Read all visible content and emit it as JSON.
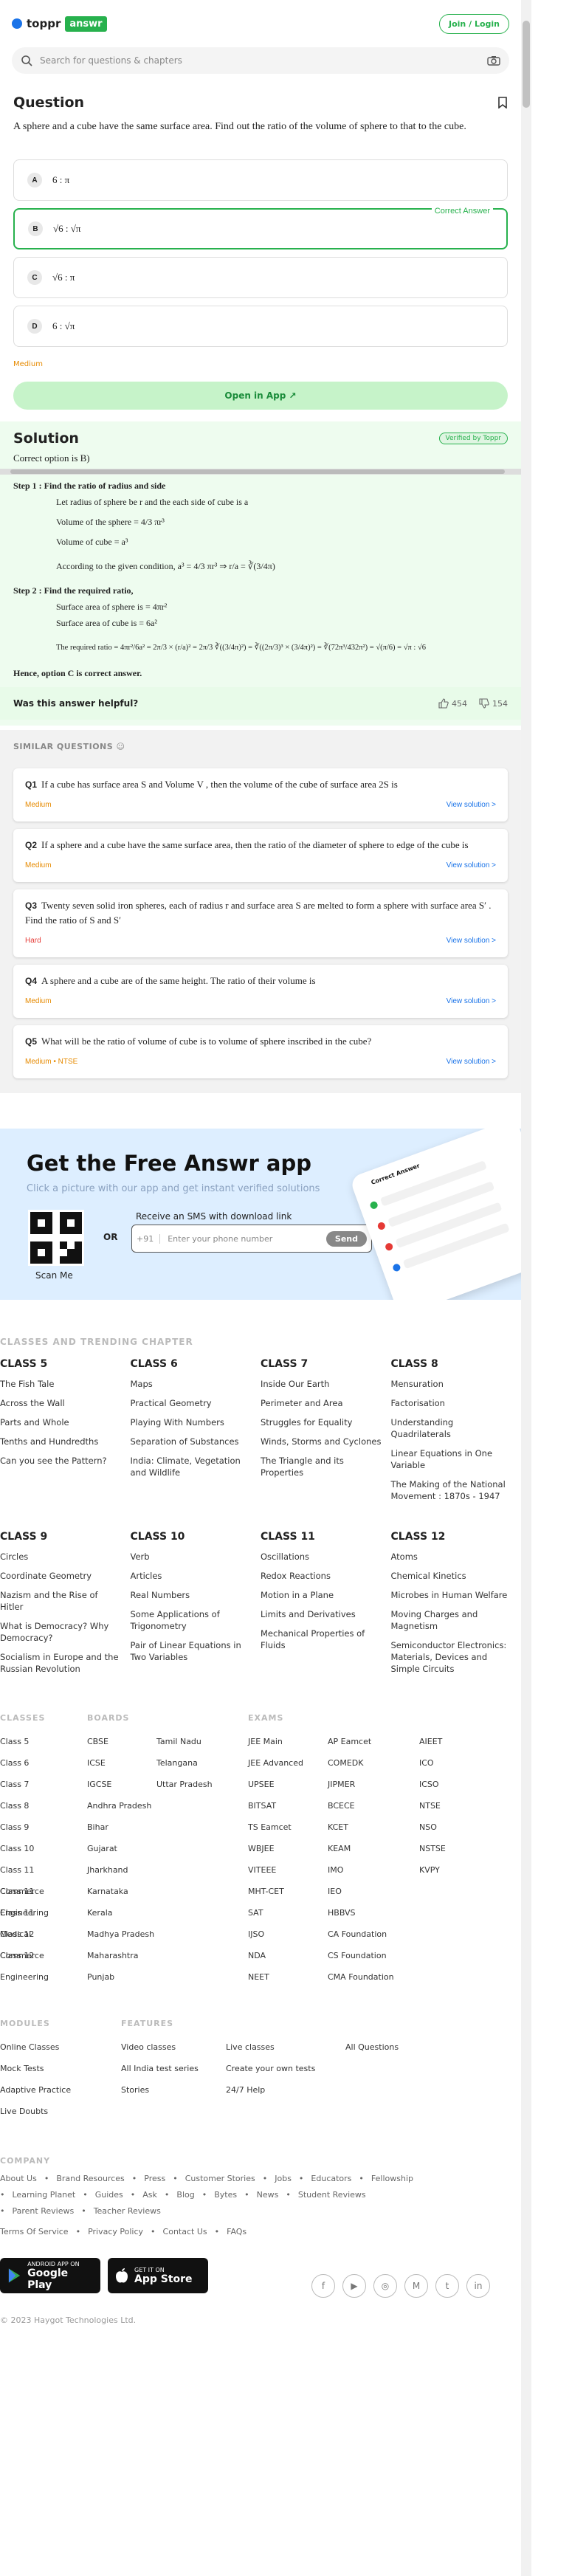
{
  "header": {
    "brand_left": "toppr",
    "brand_right": "answr",
    "login": "Join / Login"
  },
  "search": {
    "placeholder": "Search for questions & chapters"
  },
  "question": {
    "heading": "Question",
    "text": "A sphere and a cube have the same surface area. Find out the ratio of the volume of sphere to that to the cube.",
    "options": [
      {
        "letter": "A",
        "text": "6 : π"
      },
      {
        "letter": "B",
        "text": "√6 : √π",
        "correct": true
      },
      {
        "letter": "C",
        "text": "√6 : π"
      },
      {
        "letter": "D",
        "text": "6 : √π"
      }
    ],
    "correct_label": "Correct Answer",
    "difficulty": "Medium",
    "open_app": "Open in App ↗"
  },
  "solution": {
    "heading": "Solution",
    "verified": "Verified by Toppr",
    "correct_option": "Correct option is B)",
    "step1": "Step 1 : Find the ratio of radius and side",
    "step1_lines": [
      "Let radius of sphere be r and the each side of cube is a",
      "Volume of the sphere = 4/3 πr³",
      "Volume of cube = a³",
      "According to the given condition, a³ = 4/3 πr³ ⇒ r/a = ∛(3/4π)"
    ],
    "step2": "Step 2 : Find the required ratio,",
    "step2_lines": [
      "Surface area of sphere is = 4πr²",
      "Surface area of cube is = 6a²",
      "The required ratio = 4πr²/6a² = 2π/3 × (r/a)² = 2π/3 ∛((3/4π)²) = ∛((2π/3)³ × (3/4π)²) = ∛(72π³/432π²) = √(π/6) = √π : √6"
    ],
    "hence": "Hence, option C is correct answer.",
    "helpful": "Was this answer helpful?",
    "likes": "454",
    "dislikes": "154"
  },
  "similar": {
    "title": "SIMILAR QUESTIONS",
    "items": [
      {
        "n": "Q1",
        "text": "If a cube has surface area S and Volume V , then the volume of the cube of surface area 2S is",
        "difficulty": "Medium",
        "cta": "View solution >"
      },
      {
        "n": "Q2",
        "text": "If a sphere and a cube have the same surface area, then the ratio of the diameter of sphere to edge of the cube is",
        "difficulty": "Medium",
        "cta": "View solution >"
      },
      {
        "n": "Q3",
        "text": "Twenty seven solid iron spheres, each of radius r and surface area S are melted to form a sphere with surface area S′ . Find the ratio of S and S′",
        "difficulty": "Hard",
        "cta": "View solution >"
      },
      {
        "n": "Q4",
        "text": "A sphere and a cube are of the same height. The ratio of their volume is",
        "difficulty": "Medium",
        "cta": "View solution >"
      },
      {
        "n": "Q5",
        "text": "What will be the ratio of volume of cube is to volume of sphere inscribed in the cube?",
        "difficulty": "Medium • NTSE",
        "cta": "View solution >"
      }
    ]
  },
  "app": {
    "title": "Get the Free Answr app",
    "subtitle": "Click a picture with our app and get instant verified solutions",
    "scan": "Scan Me",
    "or": "OR",
    "sms": "Receive an SMS with download link",
    "cc": "+91",
    "phone_placeholder": "Enter your phone number",
    "send": "Send",
    "mock_title": "Correct Answer"
  },
  "classes": {
    "heading": "CLASSES AND TRENDING CHAPTER",
    "groups": [
      {
        "title": "CLASS 5",
        "items": [
          "The Fish Tale",
          "Across the Wall",
          "Parts and Whole",
          "Tenths and Hundredths",
          "Can you see the Pattern?"
        ]
      },
      {
        "title": "CLASS 6",
        "items": [
          "Maps",
          "Practical Geometry",
          "Playing With Numbers",
          "Separation of Substances",
          "India: Climate, Vegetation and Wildlife"
        ]
      },
      {
        "title": "CLASS 7",
        "items": [
          "Inside Our Earth",
          "Perimeter and Area",
          "Struggles for Equality",
          "Winds, Storms and Cyclones",
          "The Triangle and its Properties"
        ]
      },
      {
        "title": "CLASS 8",
        "items": [
          "Mensuration",
          "Factorisation",
          "Understanding Quadrilaterals",
          "Linear Equations in One Variable",
          "The Making of the National Movement : 1870s - 1947"
        ]
      },
      {
        "title": "CLASS 9",
        "items": [
          "Circles",
          "Coordinate Geometry",
          "Nazism and the Rise of Hitler",
          "What is Democracy? Why Democracy?",
          "Socialism in Europe and the Russian Revolution"
        ]
      },
      {
        "title": "CLASS 10",
        "items": [
          "Verb",
          "Articles",
          "Real Numbers",
          "Some Applications of Trigonometry",
          "Pair of Linear Equations in Two Variables"
        ]
      },
      {
        "title": "CLASS 11",
        "items": [
          "Oscillations",
          "Redox Reactions",
          "Motion in a Plane",
          "Limits and Derivatives",
          "Mechanical Properties of Fluids"
        ]
      },
      {
        "title": "CLASS 12",
        "items": [
          "Atoms",
          "Chemical Kinetics",
          "Microbes in Human Welfare",
          "Moving Charges and Magnetism",
          "Semiconductor Electronics: Materials, Devices and Simple Circuits"
        ]
      }
    ]
  },
  "directory": {
    "classes_h": "CLASSES",
    "classes": [
      "Class 5",
      "Class 6",
      "Class 7",
      "Class 8",
      "Class 9",
      "Class 10",
      "Class 11 Commerce",
      "Class 11 Engineering",
      "Class 11 Medical",
      "Class 12 Commerce",
      "Class 12 Engineering"
    ],
    "boards_h": "BOARDS",
    "boards1": [
      "CBSE",
      "ICSE",
      "IGCSE",
      "Andhra Pradesh",
      "Bihar",
      "Gujarat",
      "Jharkhand",
      "Karnataka",
      "Kerala",
      "Madhya Pradesh",
      "Maharashtra",
      "Punjab"
    ],
    "boards2": [
      "Tamil Nadu",
      "Telangana",
      "Uttar Pradesh"
    ],
    "exams_h": "EXAMS",
    "exams1": [
      "JEE Main",
      "JEE Advanced",
      "UPSEE",
      "BITSAT",
      "TS Eamcet",
      "WBJEE",
      "VITEEE",
      "MHT-CET",
      "SAT",
      "IJSO",
      "NDA",
      "NEET"
    ],
    "exams2": [
      "AP Eamcet",
      "COMEDK",
      "JIPMER",
      "BCECE",
      "KCET",
      "KEAM",
      "IMO",
      "IEO",
      "HBBVS",
      "CA Foundation",
      "CS Foundation",
      "CMA Foundation"
    ],
    "exams3": [
      "AIEET",
      "ICO",
      "ICSO",
      "NTSE",
      "NSO",
      "NSTSE",
      "KVPY"
    ]
  },
  "modules": {
    "h": "MODULES",
    "col1": [
      "Online Classes",
      "Mock Tests",
      "Adaptive Practice",
      "Live Doubts"
    ],
    "features_h": "FEATURES",
    "col2": [
      "Video classes",
      "All India test series",
      "Stories"
    ],
    "col3": [
      "Live classes",
      "Create your own tests",
      "24/7 Help"
    ],
    "col4": [
      "All Questions"
    ]
  },
  "company": {
    "h": "COMPANY",
    "row1": [
      "About Us",
      "•",
      "Brand Resources",
      "•",
      "Press",
      "•",
      "Customer Stories",
      "•",
      "Jobs",
      "•",
      "Educators",
      "•",
      "Fellowship"
    ],
    "row2": [
      "•",
      "Learning Planet",
      "•",
      "Guides",
      "•",
      "Ask",
      "•",
      "Blog",
      "•",
      "Bytes",
      "•",
      "News",
      "•",
      "Student Reviews"
    ],
    "row3": [
      "•",
      "Parent Reviews",
      "•",
      "Teacher Reviews"
    ],
    "row4": [
      "Terms Of Service",
      "•",
      "Privacy Policy",
      "•",
      "Contact Us",
      "•",
      "FAQs"
    ],
    "gp_small": "ANDROID APP ON",
    "gp": "Google Play",
    "as_small": "GET IT ON",
    "as": "App Store",
    "social": [
      "f",
      "▶",
      "◎",
      "M",
      "t",
      "in"
    ],
    "copyright": "© 2023 Haygot Technologies Ltd."
  }
}
